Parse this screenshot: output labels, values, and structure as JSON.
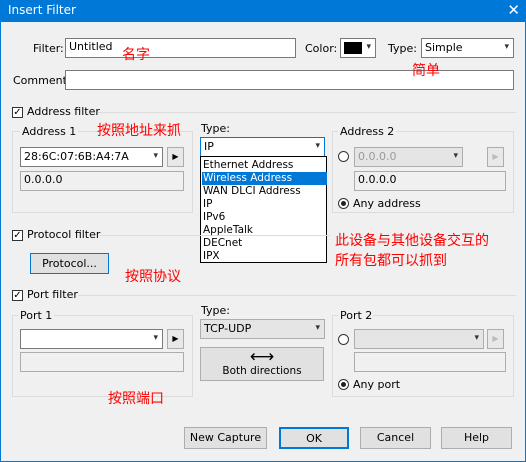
{
  "window": {
    "title": "Insert Filter",
    "close_glyph": "✕"
  },
  "header": {
    "filter_label": "Filter:",
    "filter_value": "Untitled",
    "color_label": "Color:",
    "type_label": "Type:",
    "type_value": "Simple",
    "comment_label": "Comment:",
    "comment_value": ""
  },
  "address": {
    "checkbox_label": "Address filter",
    "checked": true,
    "addr1_label": "Address 1",
    "addr1_value": "28:6C:07:6B:A4:7A",
    "addr1_sub": "0.0.0.0",
    "type_label": "Type:",
    "type_value": "IP",
    "type_options": [
      "Ethernet Address",
      "Wireless Address",
      "WAN DLCI Address",
      "IP",
      "IPv6",
      "AppleTalk",
      "DECnet",
      "IPX"
    ],
    "selected_option": "Wireless Address",
    "addr2_label": "Address 2",
    "addr2_value": "0.0.0.0",
    "addr2_sub": "0.0.0.0",
    "any_address_label": "Any address"
  },
  "protocol": {
    "checkbox_label": "Protocol filter",
    "checked": true,
    "button_label": "Protocol..."
  },
  "port": {
    "checkbox_label": "Port filter",
    "checked": true,
    "port1_label": "Port 1",
    "type_label": "Type:",
    "type_value": "TCP-UDP",
    "direction_label": "Both directions",
    "direction_glyph": "⟷",
    "port2_label": "Port 2",
    "any_port_label": "Any port"
  },
  "footer": {
    "new_capture": "New Capture",
    "ok": "OK",
    "cancel": "Cancel",
    "help": "Help"
  },
  "annotations": {
    "name": "名字",
    "simple": "简单",
    "by_address": "按照地址来抓",
    "device_line1": "此设备与其他设备交互的",
    "device_line2": "所有包都可以抓到",
    "by_protocol": "按照协议",
    "by_port": "按照端口"
  },
  "colors": {
    "accent": "#0078d7",
    "annotation": "#ff0000",
    "swatch": "#000000"
  }
}
